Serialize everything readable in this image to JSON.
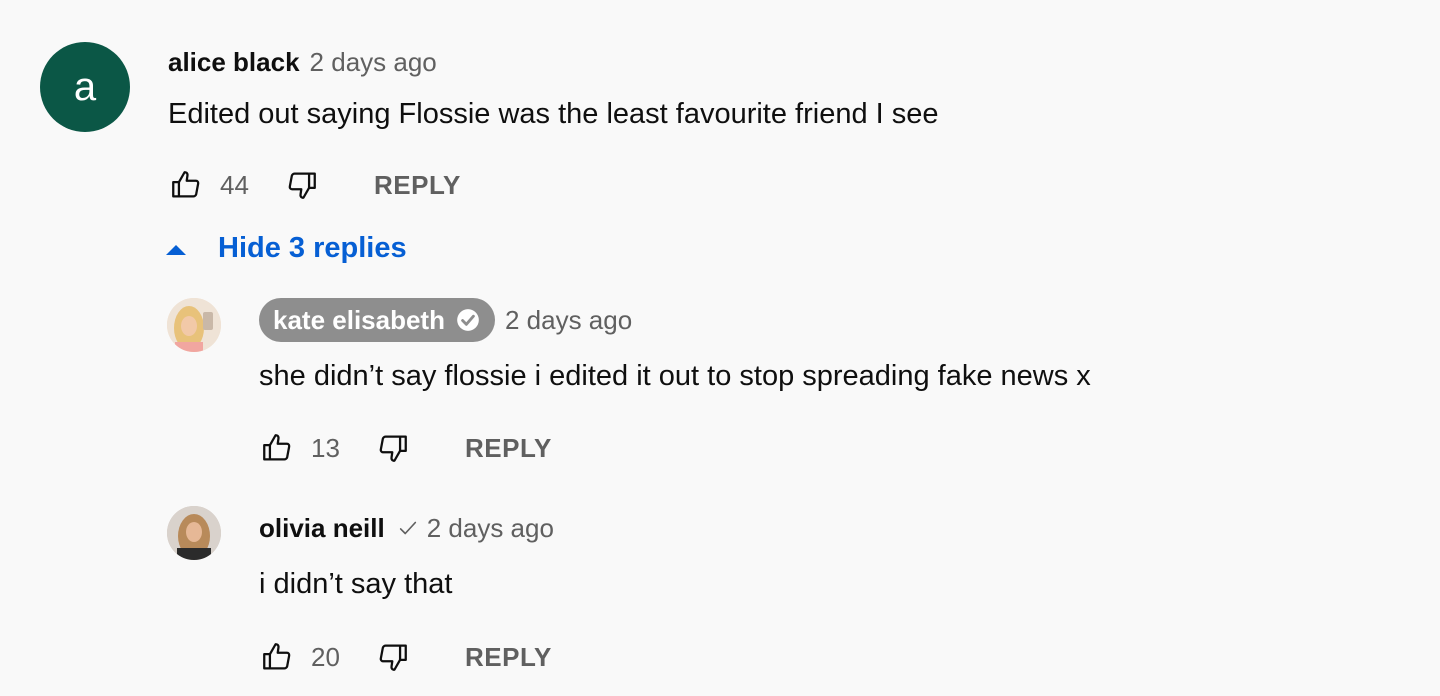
{
  "comment": {
    "avatar_letter": "a",
    "avatar_color": "#0b5746",
    "author": "alice black",
    "time": "2 days ago",
    "text": "Edited out saying Flossie was the least favourite friend I see",
    "likes": "44",
    "reply_label": "REPLY",
    "replies_toggle": "Hide 3 replies"
  },
  "replies": [
    {
      "author": "kate elisabeth",
      "author_is_creator": true,
      "verified": true,
      "time": "2 days ago",
      "text": "she didn’t say flossie i edited it out to stop spreading fake news x",
      "likes": "13",
      "reply_label": "REPLY"
    },
    {
      "author": "olivia neill",
      "verified": true,
      "time": "2 days ago",
      "text": "i didn’t say that",
      "likes": "20",
      "reply_label": "REPLY"
    }
  ],
  "colors": {
    "background": "#f9f9f9",
    "link_blue": "#065fd4",
    "secondary_text": "#606060",
    "creator_chip": "#8e8e8e"
  },
  "icons": [
    "thumbs-up-icon",
    "thumbs-down-icon",
    "verified-icon",
    "check-icon",
    "triangle-up-icon"
  ]
}
